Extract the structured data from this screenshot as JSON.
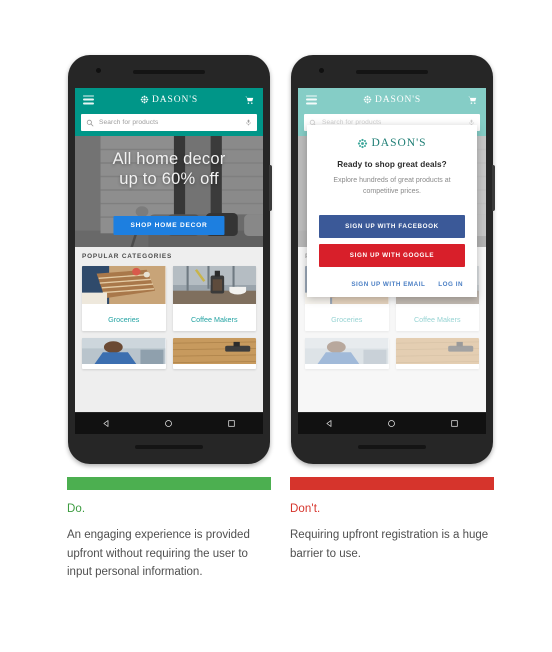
{
  "brand": {
    "name": "DASON'S",
    "mark_icon": "rosette-flower-icon",
    "teal": "#009688",
    "modal_teal": "#1d7d74"
  },
  "panels": [
    {
      "key": "do",
      "accent_color": "#4caf50",
      "label": "Do.",
      "body": "An engaging experience is provided upfront without requiring the user to input personal information.",
      "has_modal": false
    },
    {
      "key": "dont",
      "accent_color": "#d6342c",
      "label": "Don't.",
      "body": "Requiring upfront registration is a huge barrier to use.",
      "has_modal": true
    }
  ],
  "app": {
    "appbar": {
      "menu_icon": "hamburger-menu-icon",
      "cart_icon": "shopping-cart-icon",
      "title": "DASON'S"
    },
    "search": {
      "placeholder": "Search for products",
      "value": "",
      "search_icon": "search-icon",
      "mic_icon": "microphone-icon"
    },
    "hero": {
      "headline_line1": "All home decor",
      "headline_line2": "up to 60% off",
      "cta_label": "SHOP HOME DECOR",
      "cta_color": "#1d7fe0"
    },
    "categories": {
      "heading": "POPULAR CATEGORIES",
      "items": [
        {
          "label": "Groceries",
          "thumb": "layered-cake-photo"
        },
        {
          "label": "Coffee Makers",
          "thumb": "french-press-photo"
        },
        {
          "label": "",
          "thumb": "person-blue-shirt-photo"
        },
        {
          "label": "",
          "thumb": "wooden-table-photo"
        }
      ]
    },
    "navbar": {
      "back_icon": "triangle-back-icon",
      "home_icon": "circle-home-icon",
      "recents_icon": "square-recents-icon"
    }
  },
  "modal": {
    "brand": "DASON'S",
    "title": "Ready to shop great deals?",
    "subtitle": "Explore hundreds of great products at competitive prices.",
    "buttons": [
      {
        "label": "SIGN UP WITH FACEBOOK",
        "color": "#3b5998"
      },
      {
        "label": "SIGN UP WITH GOOGLE",
        "color": "#d81f2a"
      }
    ],
    "links": [
      {
        "label": "SIGN UP WITH EMAIL"
      },
      {
        "label": "LOG IN"
      }
    ],
    "link_color": "#4b7fc4"
  }
}
